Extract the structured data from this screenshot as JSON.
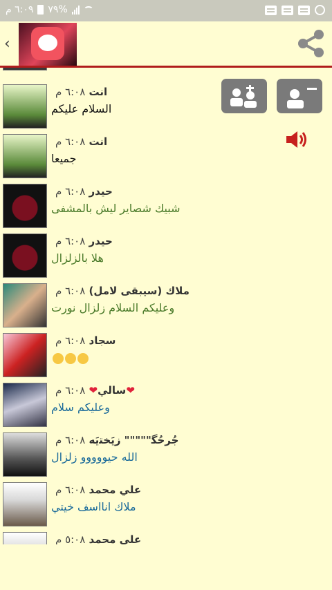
{
  "status": {
    "time": "٦:٠٩ م",
    "battery": "٧٩%"
  },
  "icons": [
    "back-icon",
    "app-icon",
    "share-icon",
    "add-group-icon",
    "remove-user-icon",
    "volume-icon"
  ],
  "colors": {
    "background": "#fffdd2",
    "divider": "#b01c1c",
    "button_gray": "#7a7a7a"
  },
  "messages": [
    {
      "time": "٦:٠٨ م",
      "sender": "انت",
      "text": "السلام عليكم",
      "color": "black"
    },
    {
      "time": "٦:٠٨ م",
      "sender": "انت",
      "text": "جميعا",
      "color": "black"
    },
    {
      "time": "٦:٠٨ م",
      "sender": "حيدر",
      "text": "شبيك شصاير ليش بالمشفى",
      "color": "green"
    },
    {
      "time": "٦:٠٨ م",
      "sender": "حيدر",
      "text": "هلا بالزلزال",
      "color": "green"
    },
    {
      "time": "٦:٠٨ م",
      "sender": "ملاك (سيبقى لامل)",
      "text": "وعليكم السلام زلزال نورت",
      "color": "green"
    },
    {
      "time": "٦:٠٨ م",
      "sender": "سجاد",
      "text": "",
      "color": "black"
    },
    {
      "time": "٦:٠٨ م",
      "sender": "سالي",
      "text": "وعليكم سلام",
      "color": "blue"
    },
    {
      "time": "٦:٠٨ م",
      "sender": "ﺟُﺮﺣُﮕ\"\"\"\"\" ﺯﻳَﺨﺘﻳَﻪ",
      "text": "الله حيووووو زلزال",
      "color": "blue"
    },
    {
      "time": "٦:٠٨ م",
      "sender": "علي محمد",
      "text": "ملاك انااسف خيتي",
      "color": "blue"
    },
    {
      "time": "٥:٠٨ م",
      "sender": "علي محمد",
      "text": "",
      "color": "blue"
    }
  ]
}
